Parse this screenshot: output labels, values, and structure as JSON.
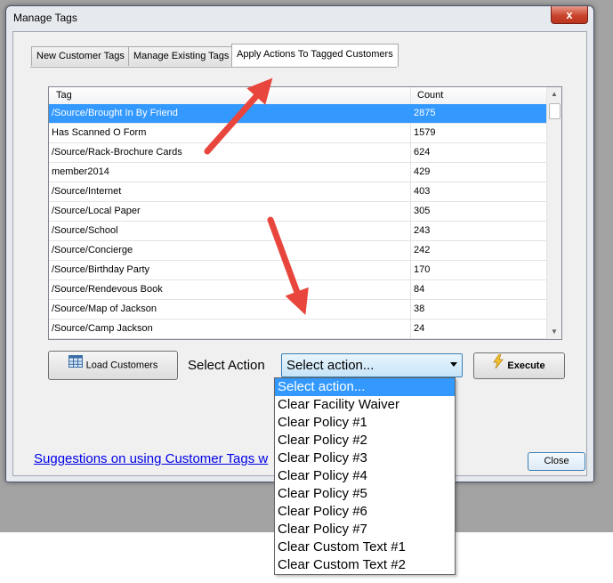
{
  "window": {
    "title": "Manage Tags",
    "close_glyph": "x"
  },
  "tabs": [
    {
      "label": "New Customer Tags",
      "active": false
    },
    {
      "label": "Manage Existing Tags",
      "active": false
    },
    {
      "label": "Apply Actions To Tagged Customers",
      "active": true
    }
  ],
  "grid": {
    "headers": {
      "tag": "Tag",
      "count": "Count"
    },
    "rows": [
      {
        "tag": "/Source/Brought In By Friend",
        "count": "2875",
        "selected": true
      },
      {
        "tag": "Has Scanned O Form",
        "count": "1579"
      },
      {
        "tag": "/Source/Rack-Brochure Cards",
        "count": "624"
      },
      {
        "tag": "member2014",
        "count": "429"
      },
      {
        "tag": "/Source/Internet",
        "count": "403"
      },
      {
        "tag": "/Source/Local Paper",
        "count": "305"
      },
      {
        "tag": "/Source/School",
        "count": "243"
      },
      {
        "tag": "/Source/Concierge",
        "count": "242"
      },
      {
        "tag": "/Source/Birthday Party",
        "count": "170"
      },
      {
        "tag": "/Source/Rendevous Book",
        "count": "84"
      },
      {
        "tag": "/Source/Map of Jackson",
        "count": "38"
      },
      {
        "tag": "/Source/Camp Jackson",
        "count": "24"
      }
    ]
  },
  "actions": {
    "load_label": "Load Customers",
    "select_label": "Select Action",
    "selected_value": "Select action...",
    "execute_label": "Execute",
    "options": [
      "Select action...",
      "Clear Facility Waiver",
      "Clear Policy #1",
      "Clear Policy #2",
      "Clear Policy #3",
      "Clear Policy #4",
      "Clear Policy #5",
      "Clear Policy #6",
      "Clear Policy #7",
      "Clear Custom Text #1",
      "Clear Custom Text #2"
    ]
  },
  "footer": {
    "link_text": "Suggestions on using Customer Tags w",
    "close_label": "Close"
  },
  "colors": {
    "selection": "#3399ff",
    "annotation_arrow": "#e8453c",
    "link": "#0000e8"
  },
  "icons": [
    "close-icon",
    "grid-icon",
    "lightning-icon",
    "dropdown-arrow-icon",
    "scroll-up-icon",
    "scroll-down-icon"
  ]
}
